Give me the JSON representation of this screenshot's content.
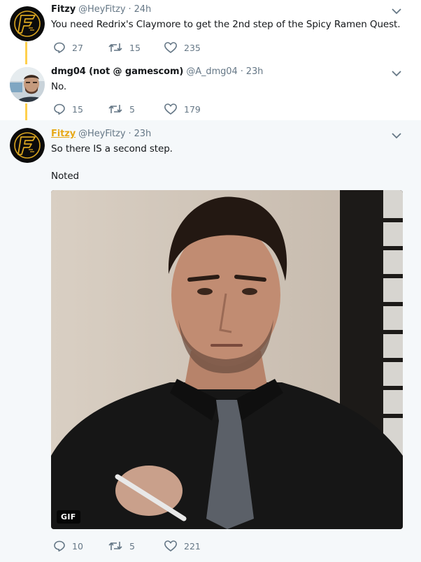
{
  "colors": {
    "accent": "#ffd04d",
    "link_name": "#e7a816",
    "muted": "#657786",
    "highlight_bg": "#f5f8fa"
  },
  "tweets": [
    {
      "name": "Fitzy",
      "handle": "@HeyFitzy",
      "separator": "·",
      "time": "24h",
      "text": "You need Redrix's Claymore to get the 2nd step of the Spicy Ramen Quest.",
      "replies": "27",
      "retweets": "15",
      "likes": "235",
      "avatar": "fitzy-logo-icon"
    },
    {
      "name": "dmg04 (not @ gamescom)",
      "handle": "@A_dmg04",
      "separator": "·",
      "time": "23h",
      "text": "No.",
      "replies": "15",
      "retweets": "5",
      "likes": "179",
      "avatar": "user-photo"
    },
    {
      "name": "Fitzy",
      "handle": "@HeyFitzy",
      "separator": "·",
      "time": "23h",
      "text_line1": "So there IS a second step.",
      "text_line2": "Noted",
      "media_badge": "GIF",
      "replies": "10",
      "retweets": "5",
      "likes": "221",
      "avatar": "fitzy-logo-icon"
    }
  ]
}
